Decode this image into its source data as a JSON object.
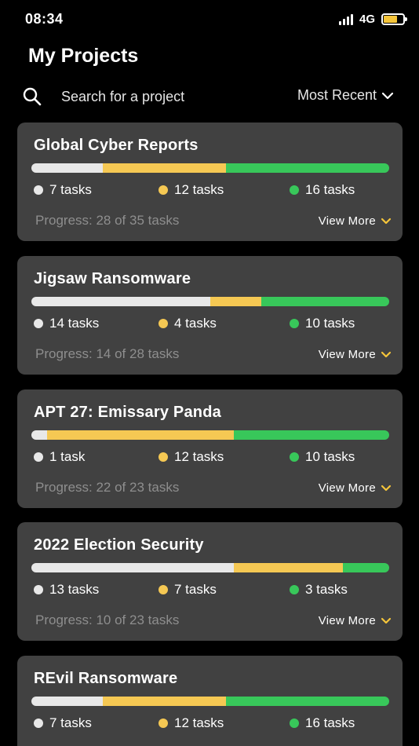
{
  "status_bar": {
    "time": "08:34",
    "network": "4G",
    "battery_level": 0.7,
    "battery_color": "#f5c53a",
    "signal_icon": "signal-bars-icon"
  },
  "header": {
    "title": "My Projects"
  },
  "search": {
    "placeholder": "Search for a project",
    "icon": "search-icon"
  },
  "sort": {
    "label": "Most Recent",
    "icon": "chevron-down-icon"
  },
  "colors": {
    "not_started": "#e8e8e8",
    "in_progress": "#f5c853",
    "done": "#38c75a",
    "card_bg": "#414141",
    "accent": "#f5c53a"
  },
  "projects": [
    {
      "title": "Global Cyber Reports",
      "gray_label": "7 tasks",
      "yellow_label": "12 tasks",
      "green_label": "16 tasks",
      "gray": 7,
      "yellow": 12,
      "green": 16,
      "progress": "Progress: 28 of 35 tasks",
      "view_more": "View More"
    },
    {
      "title": "Jigsaw Ransomware",
      "gray_label": "14 tasks",
      "yellow_label": "4 tasks",
      "green_label": "10 tasks",
      "gray": 14,
      "yellow": 4,
      "green": 10,
      "progress": "Progress: 14 of 28 tasks",
      "view_more": "View More"
    },
    {
      "title": "APT 27: Emissary Panda",
      "gray_label": "1 task",
      "yellow_label": "12 tasks",
      "green_label": "10 tasks",
      "gray": 1,
      "yellow": 12,
      "green": 10,
      "progress": "Progress: 22 of 23 tasks",
      "view_more": "View More"
    },
    {
      "title": "2022 Election Security",
      "gray_label": "13 tasks",
      "yellow_label": "7 tasks",
      "green_label": "3 tasks",
      "gray": 13,
      "yellow": 7,
      "green": 3,
      "progress": "Progress: 10 of 23 tasks",
      "view_more": "View More"
    },
    {
      "title": "REvil Ransomware",
      "gray_label": "7 tasks",
      "yellow_label": "12 tasks",
      "green_label": "16 tasks",
      "gray": 7,
      "yellow": 12,
      "green": 16,
      "progress": "",
      "view_more": ""
    }
  ]
}
